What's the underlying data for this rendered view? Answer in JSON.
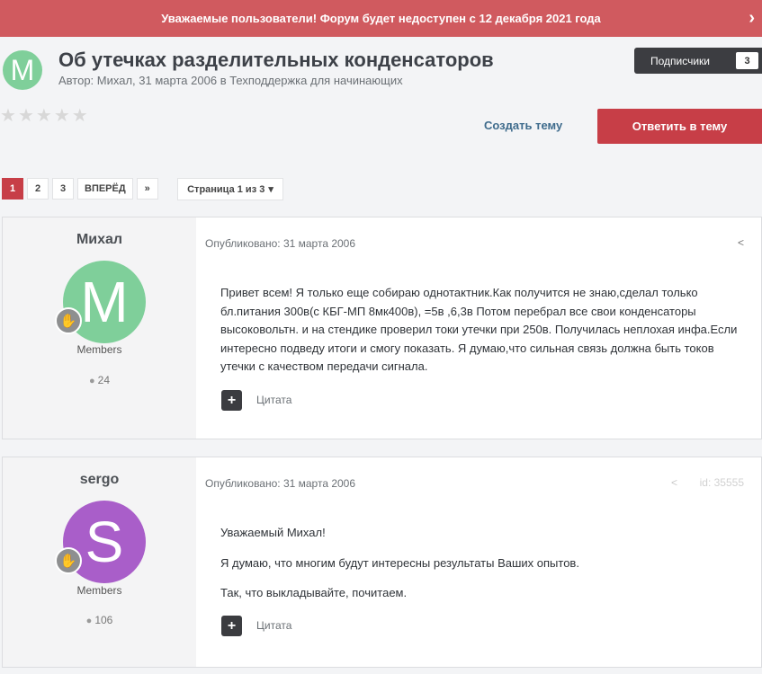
{
  "banner": {
    "text": "Уважаемые пользователи! Форум будет недоступен с 12 декабря 2021 года",
    "chevron": "›"
  },
  "topic": {
    "avatar_letter": "M",
    "title": "Об утечках разделительных конденсаторов",
    "meta_prefix": "Автор:",
    "author": "Михал,",
    "date": "31 марта 2006",
    "in_text": "в",
    "forum": "Техподдержка для начинающих",
    "rating_stars": 0,
    "rating_max": 5
  },
  "followers": {
    "label": "Подписчики",
    "count": "3"
  },
  "actions": {
    "create_topic": "Создать тему",
    "reply": "Ответить в тему"
  },
  "pagination": {
    "pages": [
      "1",
      "2",
      "3"
    ],
    "active": "1",
    "next": "ВПЕРЁД",
    "last": "»",
    "jump": "Страница 1 из 3",
    "jump_caret": "▾"
  },
  "posts": [
    {
      "username": "Михал",
      "avatar_letter": "M",
      "avatar_color": "#7fcf9a",
      "group": "Members",
      "post_count": "24",
      "published": "Опубликовано: 31 марта 2006",
      "paragraphs": [
        "Привет всем! Я только еще собираю однотактник.Как получится не знаю,сделал только бл.питания 300в(с КБГ-МП 8мк400в), =5в ,6,3в Потом перебрал все свои конденсаторы высоковольтн. и на стендике проверил токи утечки при 250в. Получилась неплохая инфа.Если интересно подведу итоги и смогу показать. Я думаю,что сильная связь должна быть токов утечки с качеством передачи сигнала."
      ],
      "quote_label": "Цитата",
      "id_text": ""
    },
    {
      "username": "sergo",
      "avatar_letter": "S",
      "avatar_color": "#a95ec9",
      "group": "Members",
      "post_count": "106",
      "published": "Опубликовано: 31 марта 2006",
      "paragraphs": [
        "Уважаемый Михал!",
        "Я думаю, что многим будут интересны результаты Ваших опытов.",
        "Так, что выкладывайте, почитаем."
      ],
      "quote_label": "Цитата",
      "id_text": "id: 35555"
    }
  ],
  "colors": {
    "accent": "#c73e47",
    "banner": "#d05a5f",
    "dark": "#3c3d41"
  },
  "icons": {
    "share": "share-icon",
    "comment": "comment-icon",
    "badge": "rank-badge-icon",
    "plus": "plus-icon"
  }
}
